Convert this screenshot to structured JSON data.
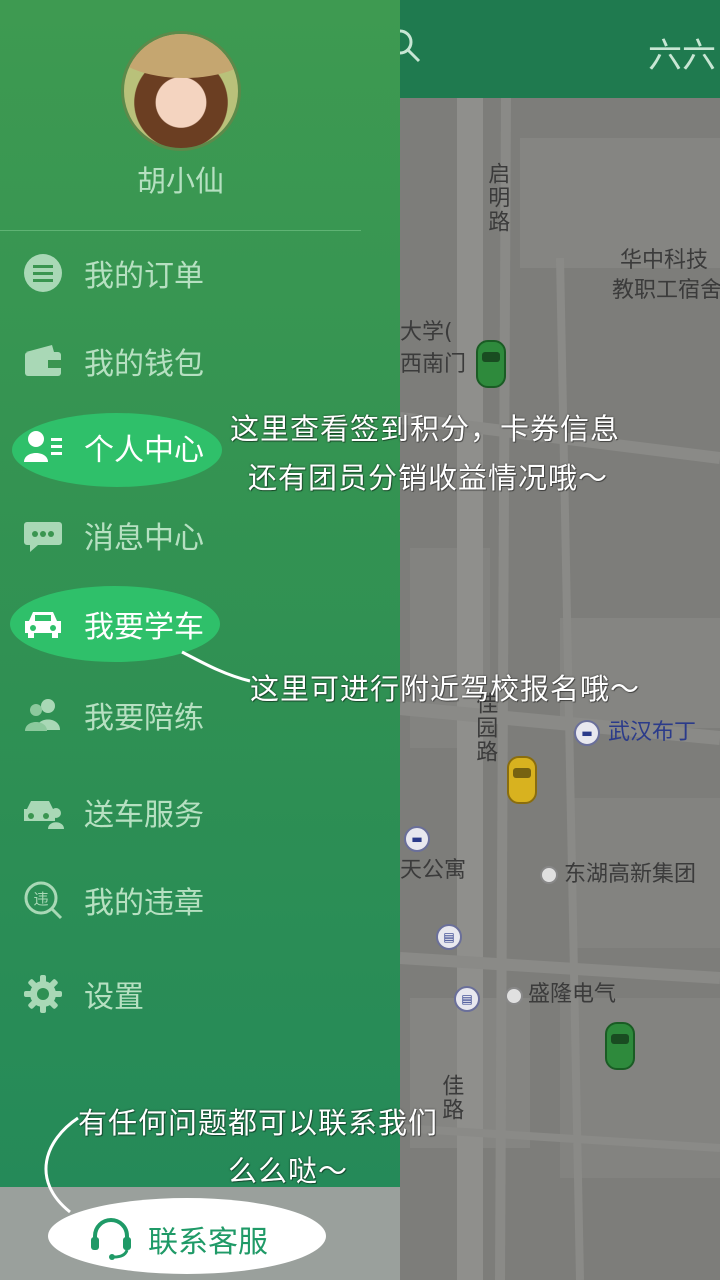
{
  "topbar": {
    "title": "六六"
  },
  "map": {
    "labels": {
      "qiming_road": "启明路",
      "hust_dorm_line1": "华中科技",
      "hust_dorm_line2": "教职工宿舍",
      "university_line1": "大学(",
      "university_line2": "西南门",
      "tafu_road": "佳园路",
      "wuhan_buding": "武汉布丁",
      "tian_apartment": "天公寓",
      "donghu_group": "东湖高新集团",
      "shenglong": "盛隆电气",
      "jia_road": "佳路"
    }
  },
  "drawer": {
    "user_name": "胡小仙",
    "menu": [
      {
        "label": "我的订单",
        "icon": "list-icon"
      },
      {
        "label": "我的钱包",
        "icon": "wallet-icon"
      },
      {
        "label": "个人中心",
        "icon": "profile-card-icon"
      },
      {
        "label": "消息中心",
        "icon": "chat-bubble-icon"
      },
      {
        "label": "我要学车",
        "icon": "car-icon"
      },
      {
        "label": "我要陪练",
        "icon": "people-icon"
      },
      {
        "label": "送车服务",
        "icon": "car-service-icon"
      },
      {
        "label": "我的违章",
        "icon": "violation-icon"
      },
      {
        "label": "设置",
        "icon": "gear-icon"
      }
    ],
    "customer_service": {
      "label": "联系客服",
      "icon": "headset-icon"
    }
  },
  "annotations": {
    "profile_line1": "这里查看签到积分，卡券信息",
    "profile_line2": "还有团员分销收益情况哦～",
    "learn_car": "这里可进行附近驾校报名哦～",
    "contact_line1": "有任何问题都可以联系我们",
    "contact_line2": "么么哒～"
  },
  "colors": {
    "drawer_green": "#2f9053",
    "highlight_green": "#2fc06a",
    "service_text": "#1f9a67"
  }
}
